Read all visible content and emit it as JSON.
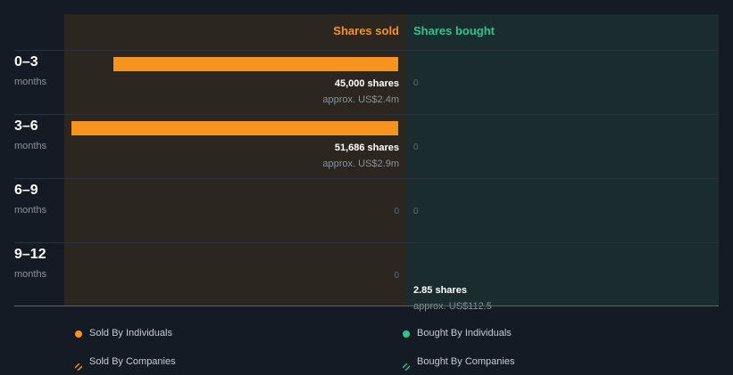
{
  "chart_data": {
    "type": "bar",
    "columns": {
      "sold": "Shares sold",
      "bought": "Shares bought"
    },
    "periods": [
      {
        "range": "0–3",
        "unit": "months",
        "sold": {
          "value": 45000,
          "label": "45,000 shares",
          "approx": "approx. US$2.4m"
        },
        "bought": {
          "value": 0,
          "label": "0"
        }
      },
      {
        "range": "3–6",
        "unit": "months",
        "sold": {
          "value": 51686,
          "label": "51,686 shares",
          "approx": "approx. US$2.9m"
        },
        "bought": {
          "value": 0,
          "label": "0"
        }
      },
      {
        "range": "6–9",
        "unit": "months",
        "sold": {
          "value": 0,
          "label": "0"
        },
        "bought": {
          "value": 0,
          "label": "0"
        }
      },
      {
        "range": "9–12",
        "unit": "months",
        "sold": {
          "value": 0,
          "label": "0"
        },
        "bought": {
          "value": 2.85,
          "label": "2.85 shares",
          "approx": "approx. US$112.5"
        }
      }
    ],
    "legend": [
      {
        "label": "Sold By Individuals",
        "marker": "dot",
        "color": "#f7931e"
      },
      {
        "label": "Bought By Individuals",
        "marker": "dot",
        "color": "#2fc48d"
      },
      {
        "label": "Sold By Companies",
        "marker": "hatch",
        "color": "#f7931e"
      },
      {
        "label": "Bought By Companies",
        "marker": "hatch",
        "color": "#2fc48d"
      }
    ],
    "colors": {
      "sold": "#f7931e",
      "bought": "#2fc48d"
    }
  }
}
